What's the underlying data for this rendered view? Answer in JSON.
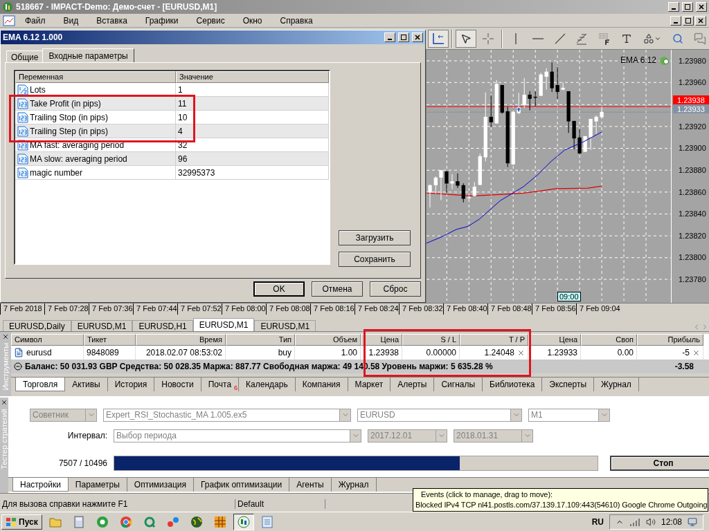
{
  "window": {
    "title": "518667 - IMPACT-Demo: Демо-счет - [EURUSD,M1]"
  },
  "menu": [
    "Файл",
    "Вид",
    "Вставка",
    "Графики",
    "Сервис",
    "Окно",
    "Справка"
  ],
  "dialog": {
    "title": "EMA 6.12 1.000",
    "tabs": [
      {
        "label": "Общие",
        "selected": false
      },
      {
        "label": "Входные параметры",
        "selected": true
      }
    ],
    "columns": [
      "Переменная",
      "Значение"
    ],
    "params": [
      {
        "kind": "double",
        "name": "Lots",
        "value": "1"
      },
      {
        "kind": "int",
        "name": "Take Profit (in pips)",
        "value": "11"
      },
      {
        "kind": "int",
        "name": "Trailing Stop (in pips)",
        "value": "10"
      },
      {
        "kind": "int",
        "name": "Trailing Step (in pips)",
        "value": "4"
      },
      {
        "kind": "int",
        "name": "MA fast: averaging period",
        "value": "32"
      },
      {
        "kind": "int",
        "name": "MA slow: averaging period",
        "value": "96"
      },
      {
        "kind": "int",
        "name": "magic number",
        "value": "32995373"
      }
    ],
    "side_buttons": [
      "Загрузить",
      "Сохранить"
    ],
    "buttons": [
      {
        "label": "OK",
        "default": true
      },
      {
        "label": "Отмена",
        "default": false
      },
      {
        "label": "Сброс",
        "default": false
      }
    ]
  },
  "toolbar": [
    {
      "kind": "axes",
      "selected": true
    },
    {
      "kind": "cursor",
      "selected": true
    },
    {
      "kind": "crosshair",
      "selected": false
    },
    {
      "kind": "vline",
      "selected": false
    },
    {
      "kind": "hline",
      "selected": false
    },
    {
      "kind": "trend",
      "selected": false
    },
    {
      "kind": "fibo",
      "selected": false
    },
    {
      "kind": "grid",
      "selected": false
    },
    {
      "kind": "text",
      "selected": false
    },
    {
      "kind": "shapes",
      "selected": false
    },
    {
      "kind": "zoom",
      "selected": false
    },
    {
      "kind": "chat",
      "selected": false
    }
  ],
  "chart": {
    "indicator": "EMA 6.12",
    "time_marker": "09:00",
    "price_axis": [
      {
        "kind": "label",
        "text": "1.23980"
      },
      {
        "kind": "label",
        "text": "1.23960"
      },
      {
        "kind": "tags",
        "tags": [
          {
            "text": "1.23938",
            "color": "#ff0000"
          },
          {
            "text": "1.23933",
            "color": "#8393a4"
          }
        ]
      },
      {
        "kind": "label",
        "text": "1.23920"
      },
      {
        "kind": "label",
        "text": "1.23900"
      },
      {
        "kind": "label",
        "text": "1.23880"
      },
      {
        "kind": "label",
        "text": "1.23860"
      },
      {
        "kind": "label",
        "text": "1.23840"
      },
      {
        "kind": "label",
        "text": "1.23820"
      },
      {
        "kind": "label",
        "text": "1.23800"
      },
      {
        "kind": "label",
        "text": "1.23780"
      }
    ]
  },
  "time_axis": [
    "7 Feb 2018",
    "7 Feb 07:28",
    "7 Feb 07:36",
    "7 Feb 07:44",
    "7 Feb 07:52",
    "7 Feb 08:00",
    "7 Feb 08:08",
    "7 Feb 08:16",
    "7 Feb 08:24",
    "7 Feb 08:32",
    "7 Feb 08:40",
    "7 Feb 08:48",
    "7 Feb 08:56",
    "7 Feb 09:04"
  ],
  "chart_tabs": [
    {
      "label": "EURUSD,Daily",
      "selected": false
    },
    {
      "label": "EURUSD,M1",
      "selected": false
    },
    {
      "label": "EURUSD,H1",
      "selected": false
    },
    {
      "label": "EURUSD,M1",
      "selected": true
    },
    {
      "label": "EURUSD,M1",
      "selected": false
    }
  ],
  "terminal": {
    "side_label": "Инструменты",
    "columns": [
      "Символ",
      "Тикет",
      "Время",
      "Тип",
      "Объем",
      "Цена",
      "S / L",
      "T / P",
      "Цена",
      "Своп",
      "Прибыль"
    ],
    "rows": [
      {
        "cells": [
          {
            "text": "eurusd",
            "clear": false
          },
          {
            "text": "9848089",
            "clear": false
          },
          {
            "text": "2018.02.07 08:53:02",
            "clear": false
          },
          {
            "text": "buy",
            "clear": false
          },
          {
            "text": "1.00",
            "clear": false
          },
          {
            "text": "1.23938",
            "clear": false
          },
          {
            "text": "0.00000",
            "clear": false
          },
          {
            "text": "1.24048",
            "clear": true
          },
          {
            "text": "1.23933",
            "clear": false
          },
          {
            "text": "0.00",
            "clear": false
          },
          {
            "text": "-5",
            "clear": true
          }
        ]
      }
    ],
    "summary": "Баланс: 50 031.93 GBP  Средства: 50 028.35  Маржа: 887.77  Свободная маржа: 49 140.58  Уровень маржи: 5 635.28 %",
    "total": "-3.58",
    "tabs": [
      {
        "label": "Торговля",
        "selected": true
      },
      {
        "label": "Активы",
        "selected": false
      },
      {
        "label": "История",
        "selected": false
      },
      {
        "label": "Новости",
        "selected": false
      },
      {
        "label": "Почта",
        "selected": false,
        "badge": "6"
      },
      {
        "label": "Календарь",
        "selected": false
      },
      {
        "label": "Компания",
        "selected": false
      },
      {
        "label": "Маркет",
        "selected": false
      },
      {
        "label": "Алерты",
        "selected": false
      },
      {
        "label": "Сигналы",
        "selected": false
      },
      {
        "label": "Библиотека",
        "selected": false
      },
      {
        "label": "Эксперты",
        "selected": false
      },
      {
        "label": "Журнал",
        "selected": false
      }
    ]
  },
  "tester": {
    "side_label": "Тестер стратегий",
    "expert_type": {
      "value": "Советник",
      "disabled": true
    },
    "expert": {
      "value": "Expert_RSI_Stochastic_MA 1.005.ex5",
      "disabled": false
    },
    "symbol": {
      "value": "EURUSD",
      "disabled": false
    },
    "period": {
      "value": "M1",
      "disabled": false
    },
    "interval_label": "Интервал:",
    "interval": {
      "value": "Выбор периода",
      "disabled": false
    },
    "date_from": {
      "value": "2017.12.01",
      "disabled": true
    },
    "date_to": {
      "value": "2018.01.31",
      "disabled": true
    },
    "progress_text": "7507 / 10496",
    "progress": {
      "level": 0.715
    },
    "stop_button": "Стоп",
    "tabs": [
      {
        "label": "Настройки",
        "selected": true
      },
      {
        "label": "Параметры",
        "selected": false
      },
      {
        "label": "Оптимизация",
        "selected": false
      },
      {
        "label": "График оптимизации",
        "selected": false
      },
      {
        "label": "Агенты",
        "selected": false
      },
      {
        "label": "Журнал",
        "selected": false
      }
    ]
  },
  "status_bar": [
    "Для вызова справки нажмите F1",
    "Default"
  ],
  "notification": {
    "title": "Events (click to manage, drag to move):",
    "text": "Blocked IPv4 TCP nl41.postls.com/37.139.17.109:443(54610) Google Chrome  Outgoing"
  },
  "taskbar": {
    "start": "Пуск",
    "apps": [
      {
        "kind": "folder",
        "selected": false
      },
      {
        "kind": "calculator",
        "selected": false
      },
      {
        "kind": "greenball",
        "selected": false
      },
      {
        "kind": "browser",
        "selected": false
      },
      {
        "kind": "q",
        "selected": false
      },
      {
        "kind": "dots",
        "selected": false
      },
      {
        "kind": "globe",
        "selected": false
      },
      {
        "kind": "grid",
        "selected": false
      },
      {
        "kind": "trader",
        "selected": true
      },
      {
        "kind": "notepad",
        "selected": false
      }
    ],
    "language": "RU",
    "clock": "12:08"
  }
}
